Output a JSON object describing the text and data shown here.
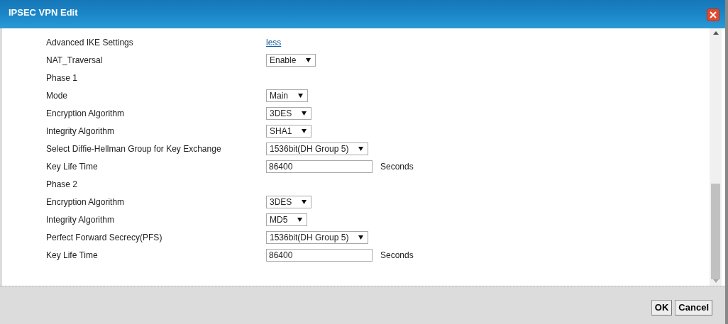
{
  "window": {
    "title": "IPSEC VPN Edit"
  },
  "rows": [
    {
      "kind": "link",
      "label": "Advanced IKE Settings",
      "value": "less"
    },
    {
      "kind": "select",
      "label": "NAT_Traversal",
      "value": "Enable"
    },
    {
      "kind": "heading",
      "label": "Phase 1"
    },
    {
      "kind": "select",
      "label": "Mode",
      "value": "Main"
    },
    {
      "kind": "select",
      "label": "Encryption Algorithm",
      "value": "3DES"
    },
    {
      "kind": "select",
      "label": "Integrity Algorithm",
      "value": "SHA1"
    },
    {
      "kind": "select",
      "label": "Select Diffie-Hellman Group for Key Exchange",
      "value": "1536bit(DH Group 5)"
    },
    {
      "kind": "input",
      "label": "Key Life Time",
      "value": "86400",
      "unit": "Seconds"
    },
    {
      "kind": "heading",
      "label": "Phase 2"
    },
    {
      "kind": "select",
      "label": "Encryption Algorithm",
      "value": "3DES"
    },
    {
      "kind": "select",
      "label": "Integrity Algorithm",
      "value": "MD5"
    },
    {
      "kind": "select",
      "label": "Perfect Forward Secrecy(PFS)",
      "value": "1536bit(DH Group 5)"
    },
    {
      "kind": "input",
      "label": "Key Life Time",
      "value": "86400",
      "unit": "Seconds"
    }
  ],
  "buttons": [
    {
      "label": "OK"
    },
    {
      "label": "Cancel"
    }
  ]
}
